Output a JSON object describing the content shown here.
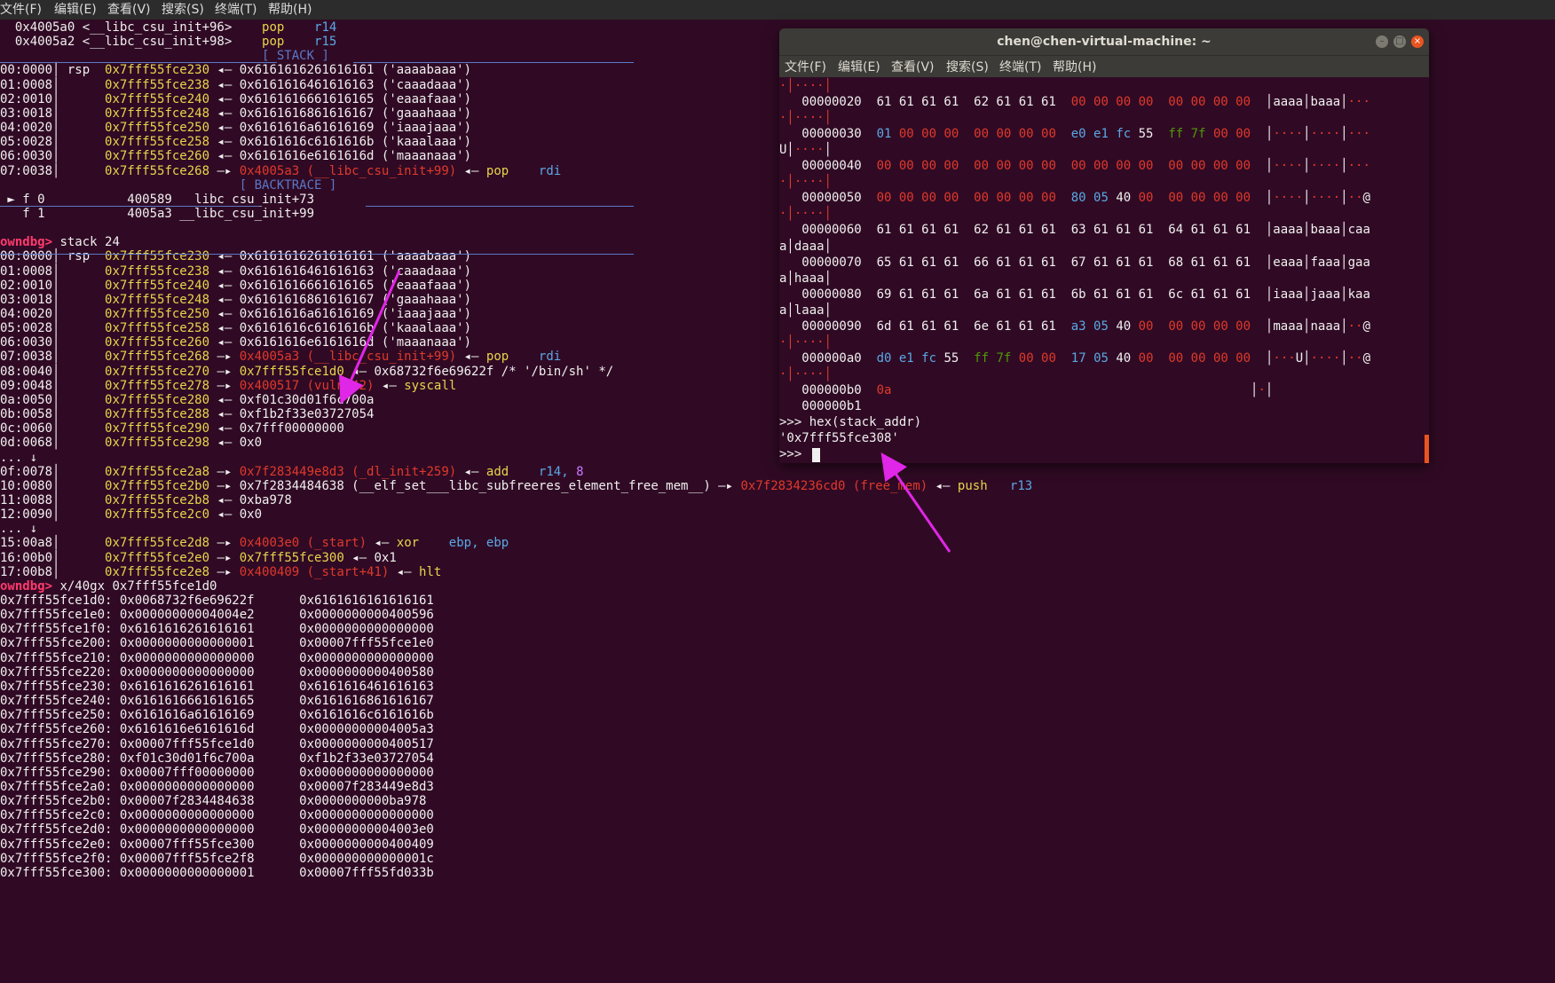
{
  "menubar": {
    "items": [
      "文件(F)",
      "编辑(E)",
      "查看(V)",
      "搜索(S)",
      "终端(T)",
      "帮助(H)"
    ]
  },
  "terminal": {
    "lines": [
      [
        [
          "  0x4005a0 <__libc_csu_init+96>    ",
          "w"
        ],
        [
          "pop",
          "y"
        ],
        [
          "    r14",
          "b"
        ]
      ],
      [
        [
          "  0x4005a2 <__libc_csu_init+98>    ",
          "w"
        ],
        [
          "pop",
          "y"
        ],
        [
          "    r15",
          "b"
        ]
      ],
      [
        [
          "                                   ",
          "w"
        ],
        [
          "[ STACK ]",
          "sep"
        ]
      ],
      [
        [
          "00:0000│ rsp  ",
          "w"
        ],
        [
          "0x7fff55fce230",
          "y"
        ],
        [
          " ◂— 0x6161616261616161 ('aaaabaaa')",
          "w"
        ]
      ],
      [
        [
          "01:0008│      ",
          "w"
        ],
        [
          "0x7fff55fce238",
          "y"
        ],
        [
          " ◂— 0x6161616461616163 ('caaadaaa')",
          "w"
        ]
      ],
      [
        [
          "02:0010│      ",
          "w"
        ],
        [
          "0x7fff55fce240",
          "y"
        ],
        [
          " ◂— 0x6161616661616165 ('eaaafaaa')",
          "w"
        ]
      ],
      [
        [
          "03:0018│      ",
          "w"
        ],
        [
          "0x7fff55fce248",
          "y"
        ],
        [
          " ◂— 0x6161616861616167 ('gaaahaaa')",
          "w"
        ]
      ],
      [
        [
          "04:0020│      ",
          "w"
        ],
        [
          "0x7fff55fce250",
          "y"
        ],
        [
          " ◂— 0x6161616a61616169 ('iaaajaaa')",
          "w"
        ]
      ],
      [
        [
          "05:0028│      ",
          "w"
        ],
        [
          "0x7fff55fce258",
          "y"
        ],
        [
          " ◂— 0x6161616c6161616b ('kaaalaaa')",
          "w"
        ]
      ],
      [
        [
          "06:0030│      ",
          "w"
        ],
        [
          "0x7fff55fce260",
          "y"
        ],
        [
          " ◂— 0x6161616e6161616d ('maaanaaa')",
          "w"
        ]
      ],
      [
        [
          "07:0038│      ",
          "w"
        ],
        [
          "0x7fff55fce268",
          "y"
        ],
        [
          " —▸ ",
          "w"
        ],
        [
          "0x4005a3 (__libc_csu_init+99)",
          "r"
        ],
        [
          " ◂— ",
          "w"
        ],
        [
          "pop",
          "y"
        ],
        [
          "    rdi",
          "b"
        ]
      ],
      [
        [
          "                                ",
          "w"
        ],
        [
          "[ BACKTRACE ]",
          "sep"
        ]
      ],
      [
        [
          " ► f 0           400589 __libc_csu_init+73",
          "w"
        ]
      ],
      [
        [
          "   f 1           4005a3 __libc_csu_init+99",
          "w"
        ]
      ],
      [
        [
          "",
          "w"
        ]
      ],
      [
        [
          "owndbg> ",
          "pr"
        ],
        [
          "stack 24",
          "w"
        ]
      ],
      [
        [
          "00:0000│ rsp  ",
          "w"
        ],
        [
          "0x7fff55fce230",
          "y"
        ],
        [
          " ◂— 0x6161616261616161 ('aaaabaaa')",
          "w"
        ]
      ],
      [
        [
          "01:0008│      ",
          "w"
        ],
        [
          "0x7fff55fce238",
          "y"
        ],
        [
          " ◂— 0x6161616461616163 ('caaadaaa')",
          "w"
        ]
      ],
      [
        [
          "02:0010│      ",
          "w"
        ],
        [
          "0x7fff55fce240",
          "y"
        ],
        [
          " ◂— 0x6161616661616165 ('eaaafaaa')",
          "w"
        ]
      ],
      [
        [
          "03:0018│      ",
          "w"
        ],
        [
          "0x7fff55fce248",
          "y"
        ],
        [
          " ◂— 0x6161616861616167 ('gaaahaaa')",
          "w"
        ]
      ],
      [
        [
          "04:0020│      ",
          "w"
        ],
        [
          "0x7fff55fce250",
          "y"
        ],
        [
          " ◂— 0x6161616a61616169 ('iaaajaaa')",
          "w"
        ]
      ],
      [
        [
          "05:0028│      ",
          "w"
        ],
        [
          "0x7fff55fce258",
          "y"
        ],
        [
          " ◂— 0x6161616c6161616b ('kaaalaaa')",
          "w"
        ]
      ],
      [
        [
          "06:0030│      ",
          "w"
        ],
        [
          "0x7fff55fce260",
          "y"
        ],
        [
          " ◂— 0x6161616e6161616d ('maaanaaa')",
          "w"
        ]
      ],
      [
        [
          "07:0038│      ",
          "w"
        ],
        [
          "0x7fff55fce268",
          "y"
        ],
        [
          " —▸ ",
          "w"
        ],
        [
          "0x4005a3 (__libc_csu_init+99)",
          "r"
        ],
        [
          " ◂— ",
          "w"
        ],
        [
          "pop",
          "y"
        ],
        [
          "    rdi",
          "b"
        ]
      ],
      [
        [
          "08:0040│      ",
          "w"
        ],
        [
          "0x7fff55fce270",
          "y"
        ],
        [
          " —▸ ",
          "w"
        ],
        [
          "0x7fff55fce1d0",
          "y"
        ],
        [
          " ◂— 0x68732f6e69622f /* '/bin/sh' */",
          "w"
        ]
      ],
      [
        [
          "09:0048│      ",
          "w"
        ],
        [
          "0x7fff55fce278",
          "y"
        ],
        [
          " —▸ ",
          "w"
        ],
        [
          "0x400517 (vuln+42)",
          "r"
        ],
        [
          " ◂— ",
          "w"
        ],
        [
          "syscall",
          "y"
        ]
      ],
      [
        [
          "0a:0050│      ",
          "w"
        ],
        [
          "0x7fff55fce280",
          "y"
        ],
        [
          " ◂— 0xf01c30d01f6c700a",
          "w"
        ]
      ],
      [
        [
          "0b:0058│      ",
          "w"
        ],
        [
          "0x7fff55fce288",
          "y"
        ],
        [
          " ◂— 0xf1b2f33e03727054",
          "w"
        ]
      ],
      [
        [
          "0c:0060│      ",
          "w"
        ],
        [
          "0x7fff55fce290",
          "y"
        ],
        [
          " ◂— 0x7fff00000000",
          "w"
        ]
      ],
      [
        [
          "0d:0068│      ",
          "w"
        ],
        [
          "0x7fff55fce298",
          "y"
        ],
        [
          " ◂— 0x0",
          "w"
        ]
      ],
      [
        [
          "... ↓",
          "w"
        ]
      ],
      [
        [
          "0f:0078│      ",
          "w"
        ],
        [
          "0x7fff55fce2a8",
          "y"
        ],
        [
          " —▸ ",
          "w"
        ],
        [
          "0x7f283449e8d3 (_dl_init+259)",
          "r"
        ],
        [
          " ◂— ",
          "w"
        ],
        [
          "add",
          "y"
        ],
        [
          "    r14, ",
          "b"
        ],
        [
          "8",
          "p"
        ]
      ],
      [
        [
          "10:0080│      ",
          "w"
        ],
        [
          "0x7fff55fce2b0",
          "y"
        ],
        [
          " —▸ 0x7f2834484638 (__elf_set___libc_subfreeres_element_free_mem__) —▸ ",
          "w"
        ],
        [
          "0x7f2834236cd0 (free_mem)",
          "r"
        ],
        [
          " ◂— ",
          "w"
        ],
        [
          "push",
          "y"
        ],
        [
          "   r13",
          "b"
        ]
      ],
      [
        [
          "11:0088│      ",
          "w"
        ],
        [
          "0x7fff55fce2b8",
          "y"
        ],
        [
          " ◂— 0xba978",
          "w"
        ]
      ],
      [
        [
          "12:0090│      ",
          "w"
        ],
        [
          "0x7fff55fce2c0",
          "y"
        ],
        [
          " ◂— 0x0",
          "w"
        ]
      ],
      [
        [
          "... ↓",
          "w"
        ]
      ],
      [
        [
          "15:00a8│      ",
          "w"
        ],
        [
          "0x7fff55fce2d8",
          "y"
        ],
        [
          " —▸ ",
          "w"
        ],
        [
          "0x4003e0 (_start)",
          "r"
        ],
        [
          " ◂— ",
          "w"
        ],
        [
          "xor",
          "y"
        ],
        [
          "    ebp, ebp",
          "b"
        ]
      ],
      [
        [
          "16:00b0│      ",
          "w"
        ],
        [
          "0x7fff55fce2e0",
          "y"
        ],
        [
          " —▸ ",
          "w"
        ],
        [
          "0x7fff55fce300",
          "y"
        ],
        [
          " ◂— 0x1",
          "w"
        ]
      ],
      [
        [
          "17:00b8│      ",
          "w"
        ],
        [
          "0x7fff55fce2e8",
          "y"
        ],
        [
          " —▸ ",
          "w"
        ],
        [
          "0x400409 (_start+41)",
          "r"
        ],
        [
          " ◂— ",
          "w"
        ],
        [
          "hlt",
          "y"
        ]
      ],
      [
        [
          "owndbg> ",
          "pr"
        ],
        [
          "x/40gx 0x7fff55fce1d0",
          "w"
        ]
      ],
      [
        [
          "0x7fff55fce1d0: 0x0068732f6e69622f      0x6161616161616161",
          "w"
        ]
      ],
      [
        [
          "0x7fff55fce1e0: 0x00000000004004e2      0x0000000000400596",
          "w"
        ]
      ],
      [
        [
          "0x7fff55fce1f0: 0x6161616261616161      0x0000000000000000",
          "w"
        ]
      ],
      [
        [
          "0x7fff55fce200: 0x0000000000000001      0x00007fff55fce1e0",
          "w"
        ]
      ],
      [
        [
          "0x7fff55fce210: 0x0000000000000000      0x0000000000000000",
          "w"
        ]
      ],
      [
        [
          "0x7fff55fce220: 0x0000000000000000      0x0000000000400580",
          "w"
        ]
      ],
      [
        [
          "0x7fff55fce230: 0x6161616261616161      0x6161616461616163",
          "w"
        ]
      ],
      [
        [
          "0x7fff55fce240: 0x6161616661616165      0x6161616861616167",
          "w"
        ]
      ],
      [
        [
          "0x7fff55fce250: 0x6161616a61616169      0x6161616c6161616b",
          "w"
        ]
      ],
      [
        [
          "0x7fff55fce260: 0x6161616e6161616d      0x00000000004005a3",
          "w"
        ]
      ],
      [
        [
          "0x7fff55fce270: 0x00007fff55fce1d0      0x0000000000400517",
          "w"
        ]
      ],
      [
        [
          "0x7fff55fce280: 0xf01c30d01f6c700a      0xf1b2f33e03727054",
          "w"
        ]
      ],
      [
        [
          "0x7fff55fce290: 0x00007fff00000000      0x0000000000000000",
          "w"
        ]
      ],
      [
        [
          "0x7fff55fce2a0: 0x0000000000000000      0x00007f283449e8d3",
          "w"
        ]
      ],
      [
        [
          "0x7fff55fce2b0: 0x00007f2834484638      0x0000000000ba978",
          "w"
        ]
      ],
      [
        [
          "0x7fff55fce2c0: 0x0000000000000000      0x0000000000000000",
          "w"
        ]
      ],
      [
        [
          "0x7fff55fce2d0: 0x0000000000000000      0x00000000004003e0",
          "w"
        ]
      ],
      [
        [
          "0x7fff55fce2e0: 0x00007fff55fce300      0x0000000000400409",
          "w"
        ]
      ],
      [
        [
          "0x7fff55fce2f0: 0x00007fff55fce2f8      0x000000000000001c",
          "w"
        ]
      ],
      [
        [
          "0x7fff55fce300: 0x0000000000000001      0x00007fff55fd033b",
          "w"
        ]
      ]
    ]
  },
  "popup": {
    "title": "chen@chen-virtual-machine: ~",
    "menu": [
      "文件(F)",
      "编辑(E)",
      "查看(V)",
      "搜索(S)",
      "终端(T)",
      "帮助(H)"
    ],
    "lines": [
      [
        [
          "·│····│",
          "r"
        ]
      ],
      [
        [
          "   00000020  61 61 61 61  62 61 61 61  ",
          "w"
        ],
        [
          "00 00 00 00  00 00 00 00",
          "r"
        ],
        [
          "  │aaaa│baaa│",
          "w"
        ],
        [
          "···",
          "r"
        ]
      ],
      [
        [
          "·│····│",
          "r"
        ]
      ],
      [
        [
          "   00000030  ",
          "w"
        ],
        [
          "01",
          "b"
        ],
        [
          " ",
          "w"
        ],
        [
          "00 00 00  00 00 00 00",
          "r"
        ],
        [
          "  ",
          "w"
        ],
        [
          "e0 e1 fc",
          "b"
        ],
        [
          " 55  ",
          "w"
        ],
        [
          "ff 7f",
          "g"
        ],
        [
          " ",
          "w"
        ],
        [
          "00 00",
          "r"
        ],
        [
          "  │",
          "w"
        ],
        [
          "····",
          "r"
        ],
        [
          "│",
          "w"
        ],
        [
          "····",
          "r"
        ],
        [
          "│",
          "w"
        ],
        [
          "···",
          "r"
        ]
      ],
      [
        [
          "U│",
          "w"
        ],
        [
          "····",
          "r"
        ],
        [
          "│",
          "w"
        ]
      ],
      [
        [
          "   00000040  ",
          "w"
        ],
        [
          "00 00 00 00  00 00 00 00  00 00 00 00  00 00 00 00",
          "r"
        ],
        [
          "  │",
          "w"
        ],
        [
          "····",
          "r"
        ],
        [
          "│",
          "w"
        ],
        [
          "····",
          "r"
        ],
        [
          "│",
          "w"
        ],
        [
          "···",
          "r"
        ]
      ],
      [
        [
          "·│····│",
          "r"
        ]
      ],
      [
        [
          "   00000050  ",
          "w"
        ],
        [
          "00 00 00 00  00 00 00 00",
          "r"
        ],
        [
          "  ",
          "w"
        ],
        [
          "80 05",
          "b"
        ],
        [
          " 40 ",
          "w"
        ],
        [
          "00",
          "r"
        ],
        [
          "  ",
          "w"
        ],
        [
          "00 00 00 00",
          "r"
        ],
        [
          "  │",
          "w"
        ],
        [
          "····",
          "r"
        ],
        [
          "│",
          "w"
        ],
        [
          "····",
          "r"
        ],
        [
          "│",
          "w"
        ],
        [
          "··",
          "r"
        ],
        [
          "@",
          "w"
        ]
      ],
      [
        [
          "·│····│",
          "r"
        ]
      ],
      [
        [
          "   00000060  61 61 61 61  62 61 61 61  63 61 61 61  64 61 61 61  │aaaa│baaa│caa",
          "w"
        ]
      ],
      [
        [
          "a│daaa│",
          "w"
        ]
      ],
      [
        [
          "   00000070  65 61 61 61  66 61 61 61  67 61 61 61  68 61 61 61  │eaaa│faaa│gaa",
          "w"
        ]
      ],
      [
        [
          "a│haaa│",
          "w"
        ]
      ],
      [
        [
          "   00000080  69 61 61 61  6a 61 61 61  6b 61 61 61  6c 61 61 61  │iaaa│jaaa│kaa",
          "w"
        ]
      ],
      [
        [
          "a│laaa│",
          "w"
        ]
      ],
      [
        [
          "   00000090  6d 61 61 61  6e 61 61 61  ",
          "w"
        ],
        [
          "a3 05",
          "b"
        ],
        [
          " 40 ",
          "w"
        ],
        [
          "00",
          "r"
        ],
        [
          "  ",
          "w"
        ],
        [
          "00 00 00 00",
          "r"
        ],
        [
          "  │maaa│naaa│",
          "w"
        ],
        [
          "··",
          "r"
        ],
        [
          "@",
          "w"
        ]
      ],
      [
        [
          "·│····│",
          "r"
        ]
      ],
      [
        [
          "   000000a0  ",
          "w"
        ],
        [
          "d0 e1 fc",
          "b"
        ],
        [
          " 55  ",
          "w"
        ],
        [
          "ff 7f",
          "g"
        ],
        [
          " ",
          "w"
        ],
        [
          "00 00",
          "r"
        ],
        [
          "  ",
          "w"
        ],
        [
          "17 05",
          "b"
        ],
        [
          " 40 ",
          "w"
        ],
        [
          "00",
          "r"
        ],
        [
          "  ",
          "w"
        ],
        [
          "00 00 00 00",
          "r"
        ],
        [
          "  │",
          "w"
        ],
        [
          "···",
          "r"
        ],
        [
          "U│",
          "w"
        ],
        [
          "····",
          "r"
        ],
        [
          "│",
          "w"
        ],
        [
          "··",
          "r"
        ],
        [
          "@",
          "w"
        ]
      ],
      [
        [
          "·│····│",
          "r"
        ]
      ],
      [
        [
          "   000000b0  ",
          "w"
        ],
        [
          "0a",
          "r"
        ],
        [
          "                                                │",
          "w"
        ],
        [
          "·",
          "r"
        ],
        [
          "│",
          "w"
        ]
      ],
      [
        [
          "   000000b1",
          "w"
        ]
      ],
      [
        [
          ">>> hex(stack_addr)",
          "w"
        ]
      ],
      [
        [
          "'0x7fff55fce308'",
          "w"
        ]
      ],
      [
        [
          ">>> ",
          "w"
        ]
      ]
    ]
  },
  "colors": {
    "terminal_bg": "#300a24",
    "arrow": "#e026e6",
    "accent": "#e95420"
  }
}
